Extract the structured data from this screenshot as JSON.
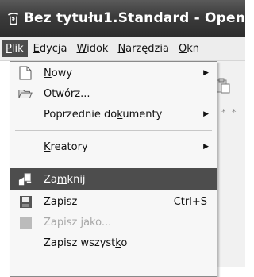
{
  "window": {
    "title": "Bez tytułu1.Standard - Open",
    "app_icon": "openoffice-gull-icon"
  },
  "menubar": {
    "items": [
      "Plik",
      "Edycja",
      "Widok",
      "Narzędzia",
      "Okn"
    ]
  },
  "toolbar": {
    "icon": "paste-icon",
    "dots": "* * *"
  },
  "file_menu": {
    "items": [
      {
        "label": "Nowy",
        "icon": "new-document-icon",
        "submenu": true
      },
      {
        "label": "Otwórz...",
        "icon": "open-folder-icon"
      },
      {
        "label": "Poprzednie dokumenty",
        "submenu": true
      },
      {
        "label": "Kreatory",
        "submenu": true
      },
      {
        "label": "Zamknij",
        "icon": "close-document-icon",
        "highlighted": true
      },
      {
        "label": "Zapisz",
        "icon": "save-icon",
        "shortcut": "Ctrl+S"
      },
      {
        "label": "Zapisz jako...",
        "icon": "save-as-icon",
        "disabled": true
      },
      {
        "label": "Zapisz wszystko"
      }
    ],
    "submenu_arrow": "▶"
  },
  "colors": {
    "titlebar": "#3b3b3b",
    "highlight": "#4d4d4d",
    "menu_bg": "#f7f7f7"
  }
}
